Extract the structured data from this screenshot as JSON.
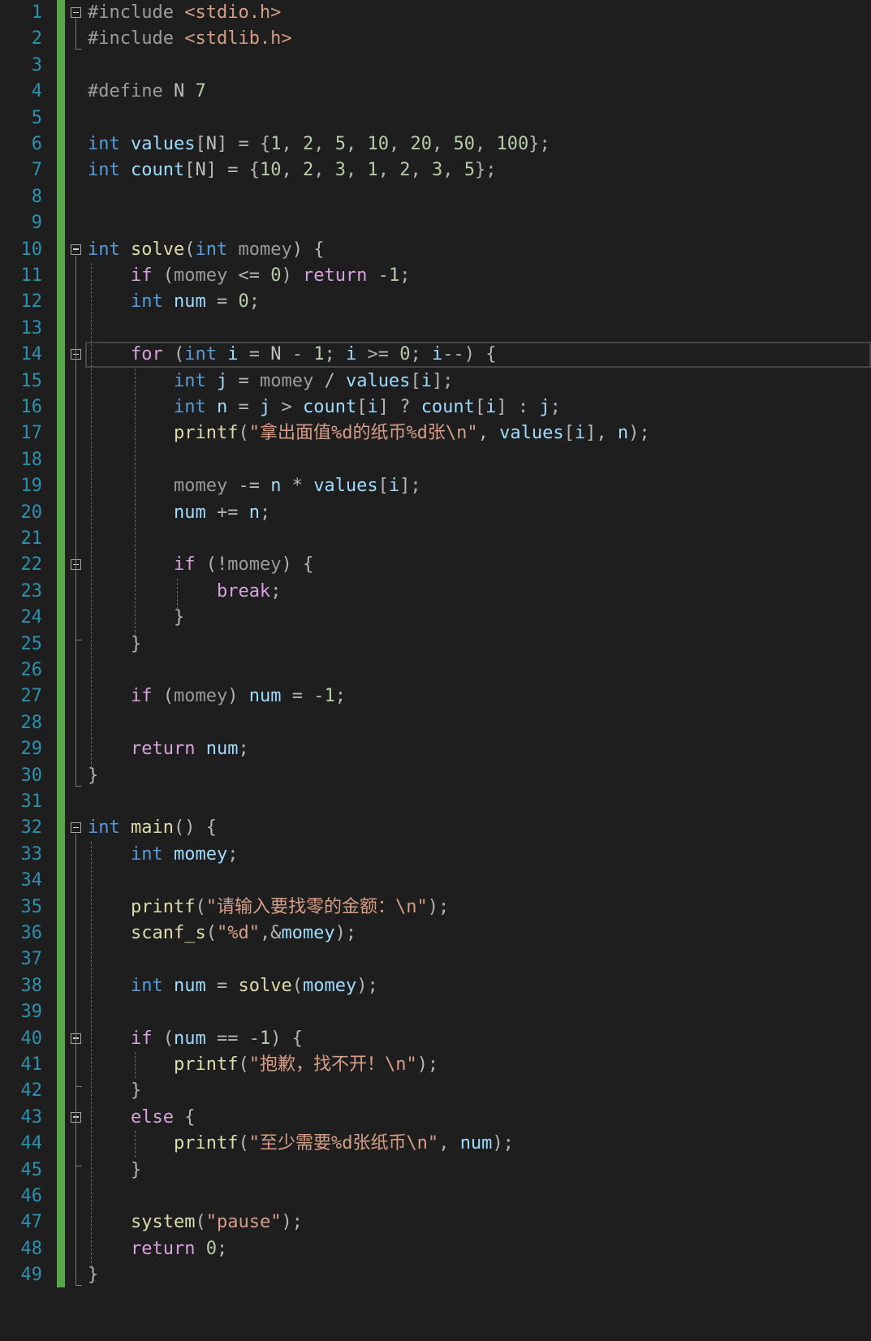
{
  "editor": {
    "colors": {
      "background": "#1e1e1e",
      "line_numbers": "#2b91af",
      "change_bar": "#57a64a",
      "keyword": "#569cd6",
      "control": "#d8a0df",
      "string": "#d69d85",
      "number": "#b5cea8",
      "function": "#dcdcaa"
    },
    "lines": [
      {
        "n": "1",
        "t": [
          [
            "pp",
            "#include "
          ],
          [
            "str",
            "<stdio.h>"
          ]
        ]
      },
      {
        "n": "2",
        "t": [
          [
            "pp",
            "#include "
          ],
          [
            "str",
            "<stdlib.h>"
          ]
        ]
      },
      {
        "n": "3",
        "t": []
      },
      {
        "n": "4",
        "t": [
          [
            "pp",
            "#define "
          ],
          [
            "mac",
            "N"
          ],
          [
            "num",
            " 7"
          ]
        ]
      },
      {
        "n": "5",
        "t": []
      },
      {
        "n": "6",
        "t": [
          [
            "kw",
            "int"
          ],
          [
            "op",
            " "
          ],
          [
            "var",
            "values"
          ],
          [
            "op",
            "["
          ],
          [
            "mac",
            "N"
          ],
          [
            "op",
            "] = {"
          ],
          [
            "num",
            "1"
          ],
          [
            "op",
            ", "
          ],
          [
            "num",
            "2"
          ],
          [
            "op",
            ", "
          ],
          [
            "num",
            "5"
          ],
          [
            "op",
            ", "
          ],
          [
            "num",
            "10"
          ],
          [
            "op",
            ", "
          ],
          [
            "num",
            "20"
          ],
          [
            "op",
            ", "
          ],
          [
            "num",
            "50"
          ],
          [
            "op",
            ", "
          ],
          [
            "num",
            "100"
          ],
          [
            "op",
            "};"
          ]
        ]
      },
      {
        "n": "7",
        "t": [
          [
            "kw",
            "int"
          ],
          [
            "op",
            " "
          ],
          [
            "var",
            "count"
          ],
          [
            "op",
            "["
          ],
          [
            "mac",
            "N"
          ],
          [
            "op",
            "] = {"
          ],
          [
            "num",
            "10"
          ],
          [
            "op",
            ", "
          ],
          [
            "num",
            "2"
          ],
          [
            "op",
            ", "
          ],
          [
            "num",
            "3"
          ],
          [
            "op",
            ", "
          ],
          [
            "num",
            "1"
          ],
          [
            "op",
            ", "
          ],
          [
            "num",
            "2"
          ],
          [
            "op",
            ", "
          ],
          [
            "num",
            "3"
          ],
          [
            "op",
            ", "
          ],
          [
            "num",
            "5"
          ],
          [
            "op",
            "};"
          ]
        ]
      },
      {
        "n": "8",
        "t": []
      },
      {
        "n": "9",
        "t": []
      },
      {
        "n": "10",
        "t": [
          [
            "kw",
            "int"
          ],
          [
            "op",
            " "
          ],
          [
            "fn",
            "solve"
          ],
          [
            "op",
            "("
          ],
          [
            "kw",
            "int"
          ],
          [
            "op",
            " "
          ],
          [
            "par",
            "momey"
          ],
          [
            "op",
            ") {"
          ]
        ]
      },
      {
        "n": "11",
        "t": [
          [
            "op",
            "    "
          ],
          [
            "ctl",
            "if"
          ],
          [
            "op",
            " ("
          ],
          [
            "par",
            "momey"
          ],
          [
            "op",
            " <= "
          ],
          [
            "num",
            "0"
          ],
          [
            "op",
            ") "
          ],
          [
            "ctl",
            "return"
          ],
          [
            "op",
            " -"
          ],
          [
            "num",
            "1"
          ],
          [
            "op",
            ";"
          ]
        ]
      },
      {
        "n": "12",
        "t": [
          [
            "op",
            "    "
          ],
          [
            "kw",
            "int"
          ],
          [
            "op",
            " "
          ],
          [
            "var",
            "num"
          ],
          [
            "op",
            " = "
          ],
          [
            "num",
            "0"
          ],
          [
            "op",
            ";"
          ]
        ]
      },
      {
        "n": "13",
        "t": []
      },
      {
        "n": "14",
        "t": [
          [
            "op",
            "    "
          ],
          [
            "ctl",
            "for"
          ],
          [
            "op",
            " ("
          ],
          [
            "kw",
            "int"
          ],
          [
            "op",
            " "
          ],
          [
            "var",
            "i"
          ],
          [
            "op",
            " = "
          ],
          [
            "mac",
            "N"
          ],
          [
            "op",
            " - "
          ],
          [
            "num",
            "1"
          ],
          [
            "op",
            "; "
          ],
          [
            "var",
            "i"
          ],
          [
            "op",
            " >= "
          ],
          [
            "num",
            "0"
          ],
          [
            "op",
            "; "
          ],
          [
            "var",
            "i"
          ],
          [
            "op",
            "--) {"
          ]
        ]
      },
      {
        "n": "15",
        "t": [
          [
            "op",
            "        "
          ],
          [
            "kw",
            "int"
          ],
          [
            "op",
            " "
          ],
          [
            "var",
            "j"
          ],
          [
            "op",
            " = "
          ],
          [
            "par",
            "momey"
          ],
          [
            "op",
            " / "
          ],
          [
            "var",
            "values"
          ],
          [
            "op",
            "["
          ],
          [
            "var",
            "i"
          ],
          [
            "op",
            "];"
          ]
        ]
      },
      {
        "n": "16",
        "t": [
          [
            "op",
            "        "
          ],
          [
            "kw",
            "int"
          ],
          [
            "op",
            " "
          ],
          [
            "var",
            "n"
          ],
          [
            "op",
            " = "
          ],
          [
            "var",
            "j"
          ],
          [
            "op",
            " > "
          ],
          [
            "var",
            "count"
          ],
          [
            "op",
            "["
          ],
          [
            "var",
            "i"
          ],
          [
            "op",
            "] ? "
          ],
          [
            "var",
            "count"
          ],
          [
            "op",
            "["
          ],
          [
            "var",
            "i"
          ],
          [
            "op",
            "] : "
          ],
          [
            "var",
            "j"
          ],
          [
            "op",
            ";"
          ]
        ]
      },
      {
        "n": "17",
        "t": [
          [
            "op",
            "        "
          ],
          [
            "fn",
            "printf"
          ],
          [
            "op",
            "("
          ],
          [
            "str",
            "\"拿出面值%d的纸币%d张\\n\""
          ],
          [
            "op",
            ", "
          ],
          [
            "var",
            "values"
          ],
          [
            "op",
            "["
          ],
          [
            "var",
            "i"
          ],
          [
            "op",
            "], "
          ],
          [
            "var",
            "n"
          ],
          [
            "op",
            ");"
          ]
        ]
      },
      {
        "n": "18",
        "t": []
      },
      {
        "n": "19",
        "t": [
          [
            "op",
            "        "
          ],
          [
            "par",
            "momey"
          ],
          [
            "op",
            " -= "
          ],
          [
            "var",
            "n"
          ],
          [
            "op",
            " * "
          ],
          [
            "var",
            "values"
          ],
          [
            "op",
            "["
          ],
          [
            "var",
            "i"
          ],
          [
            "op",
            "];"
          ]
        ]
      },
      {
        "n": "20",
        "t": [
          [
            "op",
            "        "
          ],
          [
            "var",
            "num"
          ],
          [
            "op",
            " += "
          ],
          [
            "var",
            "n"
          ],
          [
            "op",
            ";"
          ]
        ]
      },
      {
        "n": "21",
        "t": []
      },
      {
        "n": "22",
        "t": [
          [
            "op",
            "        "
          ],
          [
            "ctl",
            "if"
          ],
          [
            "op",
            " (!"
          ],
          [
            "par",
            "momey"
          ],
          [
            "op",
            ") {"
          ]
        ]
      },
      {
        "n": "23",
        "t": [
          [
            "op",
            "            "
          ],
          [
            "ctl",
            "break"
          ],
          [
            "op",
            ";"
          ]
        ]
      },
      {
        "n": "24",
        "t": [
          [
            "op",
            "        }"
          ]
        ]
      },
      {
        "n": "25",
        "t": [
          [
            "op",
            "    }"
          ]
        ]
      },
      {
        "n": "26",
        "t": []
      },
      {
        "n": "27",
        "t": [
          [
            "op",
            "    "
          ],
          [
            "ctl",
            "if"
          ],
          [
            "op",
            " ("
          ],
          [
            "par",
            "momey"
          ],
          [
            "op",
            ") "
          ],
          [
            "var",
            "num"
          ],
          [
            "op",
            " = -"
          ],
          [
            "num",
            "1"
          ],
          [
            "op",
            ";"
          ]
        ]
      },
      {
        "n": "28",
        "t": []
      },
      {
        "n": "29",
        "t": [
          [
            "op",
            "    "
          ],
          [
            "ctl",
            "return"
          ],
          [
            "op",
            " "
          ],
          [
            "var",
            "num"
          ],
          [
            "op",
            ";"
          ]
        ]
      },
      {
        "n": "30",
        "t": [
          [
            "op",
            "}"
          ]
        ]
      },
      {
        "n": "31",
        "t": []
      },
      {
        "n": "32",
        "t": [
          [
            "kw",
            "int"
          ],
          [
            "op",
            " "
          ],
          [
            "fn",
            "main"
          ],
          [
            "op",
            "() {"
          ]
        ]
      },
      {
        "n": "33",
        "t": [
          [
            "op",
            "    "
          ],
          [
            "kw",
            "int"
          ],
          [
            "op",
            " "
          ],
          [
            "var",
            "momey"
          ],
          [
            "op",
            ";"
          ]
        ]
      },
      {
        "n": "34",
        "t": []
      },
      {
        "n": "35",
        "t": [
          [
            "op",
            "    "
          ],
          [
            "fn",
            "printf"
          ],
          [
            "op",
            "("
          ],
          [
            "str",
            "\"请输入要找零的金额：\\n\""
          ],
          [
            "op",
            ");"
          ]
        ]
      },
      {
        "n": "36",
        "t": [
          [
            "op",
            "    "
          ],
          [
            "fn",
            "scanf_s"
          ],
          [
            "op",
            "("
          ],
          [
            "str",
            "\"%d\""
          ],
          [
            "op",
            ",&"
          ],
          [
            "var",
            "momey"
          ],
          [
            "op",
            ");"
          ]
        ]
      },
      {
        "n": "37",
        "t": []
      },
      {
        "n": "38",
        "t": [
          [
            "op",
            "    "
          ],
          [
            "kw",
            "int"
          ],
          [
            "op",
            " "
          ],
          [
            "var",
            "num"
          ],
          [
            "op",
            " = "
          ],
          [
            "fn",
            "solve"
          ],
          [
            "op",
            "("
          ],
          [
            "var",
            "momey"
          ],
          [
            "op",
            ");"
          ]
        ]
      },
      {
        "n": "39",
        "t": []
      },
      {
        "n": "40",
        "t": [
          [
            "op",
            "    "
          ],
          [
            "ctl",
            "if"
          ],
          [
            "op",
            " ("
          ],
          [
            "var",
            "num"
          ],
          [
            "op",
            " == -"
          ],
          [
            "num",
            "1"
          ],
          [
            "op",
            ") {"
          ]
        ]
      },
      {
        "n": "41",
        "t": [
          [
            "op",
            "        "
          ],
          [
            "fn",
            "printf"
          ],
          [
            "op",
            "("
          ],
          [
            "str",
            "\"抱歉，找不开！\\n\""
          ],
          [
            "op",
            ");"
          ]
        ]
      },
      {
        "n": "42",
        "t": [
          [
            "op",
            "    }"
          ]
        ]
      },
      {
        "n": "43",
        "t": [
          [
            "op",
            "    "
          ],
          [
            "ctl",
            "else"
          ],
          [
            "op",
            " {"
          ]
        ]
      },
      {
        "n": "44",
        "t": [
          [
            "op",
            "        "
          ],
          [
            "fn",
            "printf"
          ],
          [
            "op",
            "("
          ],
          [
            "str",
            "\"至少需要%d张纸币\\n\""
          ],
          [
            "op",
            ", "
          ],
          [
            "var",
            "num"
          ],
          [
            "op",
            ");"
          ]
        ]
      },
      {
        "n": "45",
        "t": [
          [
            "op",
            "    }"
          ]
        ]
      },
      {
        "n": "46",
        "t": []
      },
      {
        "n": "47",
        "t": [
          [
            "op",
            "    "
          ],
          [
            "fn",
            "system"
          ],
          [
            "op",
            "("
          ],
          [
            "str",
            "\"pause\""
          ],
          [
            "op",
            ");"
          ]
        ]
      },
      {
        "n": "48",
        "t": [
          [
            "op",
            "    "
          ],
          [
            "ctl",
            "return"
          ],
          [
            "op",
            " "
          ],
          [
            "num",
            "0"
          ],
          [
            "op",
            ";"
          ]
        ]
      },
      {
        "n": "49",
        "t": [
          [
            "op",
            "}"
          ]
        ]
      }
    ],
    "fold_lines": [
      "1",
      "10",
      "14",
      "22",
      "32",
      "40",
      "43"
    ],
    "current_line": "14"
  }
}
